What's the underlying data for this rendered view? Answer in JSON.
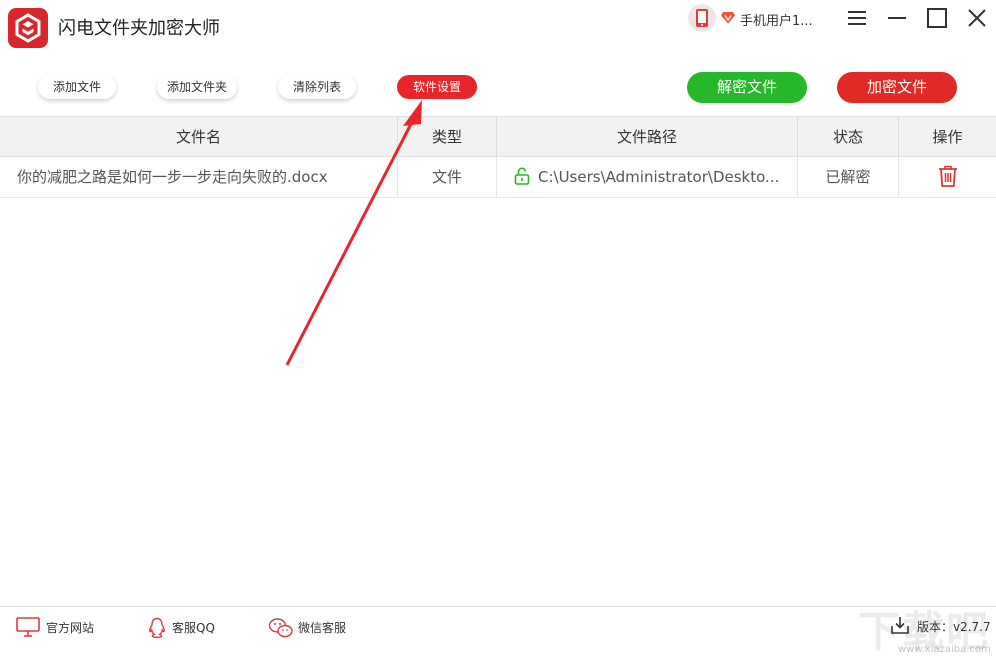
{
  "app": {
    "title": "闪电文件夹加密大师",
    "user_name": "手机用户1...",
    "brand_color": "#d9262c"
  },
  "window_controls": {
    "menu_icon": "hamburger-menu-icon",
    "minimize_icon": "minimize-icon",
    "maximize_icon": "maximize-icon",
    "close_icon": "close-icon"
  },
  "toolbar": {
    "add_file": "添加文件",
    "add_folder": "添加文件夹",
    "clear_list": "清除列表",
    "settings": "软件设置",
    "decrypt": "解密文件",
    "encrypt": "加密文件",
    "decrypt_color": "#26b829",
    "encrypt_color": "#e02a26"
  },
  "table": {
    "headers": [
      "文件名",
      "类型",
      "文件路径",
      "状态",
      "操作"
    ],
    "rows": [
      {
        "name": "你的减肥之路是如何一步一步走向失败的.docx",
        "type": "文件",
        "path": "C:\\Users\\Administrator\\Deskto...",
        "status": "已解密",
        "lock_icon": "unlocked-padlock-icon",
        "action_icon": "trash-icon"
      }
    ]
  },
  "footer": {
    "website": "官方网站",
    "qq": "客服QQ",
    "wechat": "微信客服",
    "version": "版本：v2.7.7",
    "watermark": "下载吧",
    "watermark_url": "www.xiazaiba.com"
  }
}
